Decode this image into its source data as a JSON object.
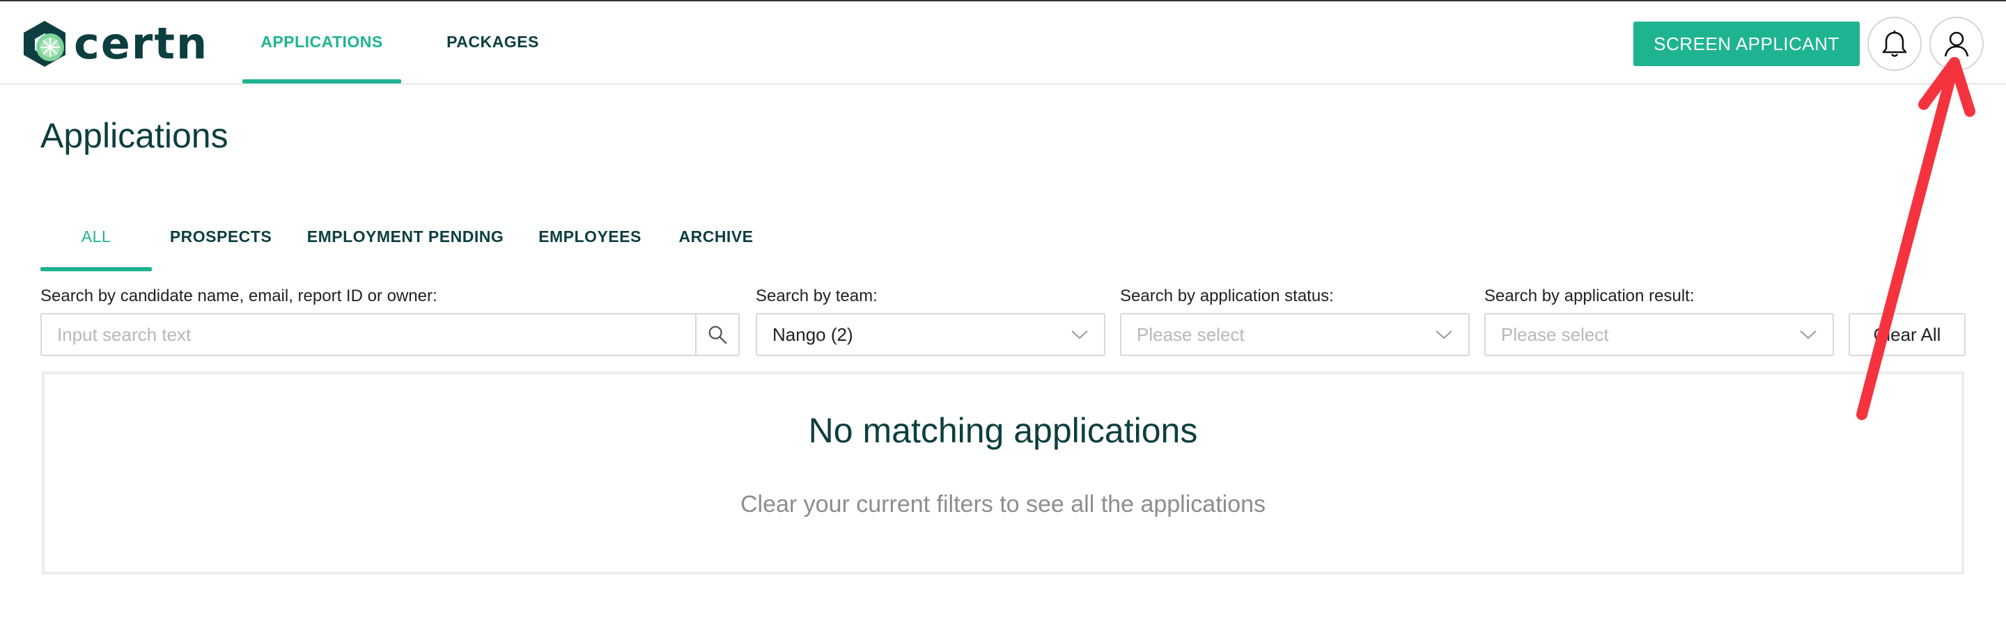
{
  "brand": {
    "name": "certn",
    "accent": "#1eb491",
    "dark": "#0d3e40"
  },
  "nav": {
    "items": [
      {
        "label": "APPLICATIONS",
        "active": true
      },
      {
        "label": "PACKAGES",
        "active": false
      }
    ],
    "screen_button": "SCREEN APPLICANT",
    "icons": [
      "bell-icon",
      "user-icon"
    ]
  },
  "page": {
    "title": "Applications",
    "tabs": [
      {
        "label": "ALL",
        "active": true
      },
      {
        "label": "PROSPECTS",
        "active": false
      },
      {
        "label": "EMPLOYMENT PENDING",
        "active": false
      },
      {
        "label": "EMPLOYEES",
        "active": false
      },
      {
        "label": "ARCHIVE",
        "active": false
      }
    ]
  },
  "filters": {
    "search": {
      "label": "Search by candidate name, email, report ID or owner:",
      "placeholder": "Input search text",
      "value": ""
    },
    "team": {
      "label": "Search by team:",
      "value": "Nango (2)"
    },
    "status": {
      "label": "Search by application status:",
      "placeholder": "Please select"
    },
    "result": {
      "label": "Search by application result:",
      "placeholder": "Please select"
    },
    "clear_label": "Clear All"
  },
  "empty_state": {
    "title": "No matching applications",
    "subtitle": "Clear your current filters to see all the applications"
  },
  "annotation": {
    "arrow_color": "#f5333f"
  }
}
